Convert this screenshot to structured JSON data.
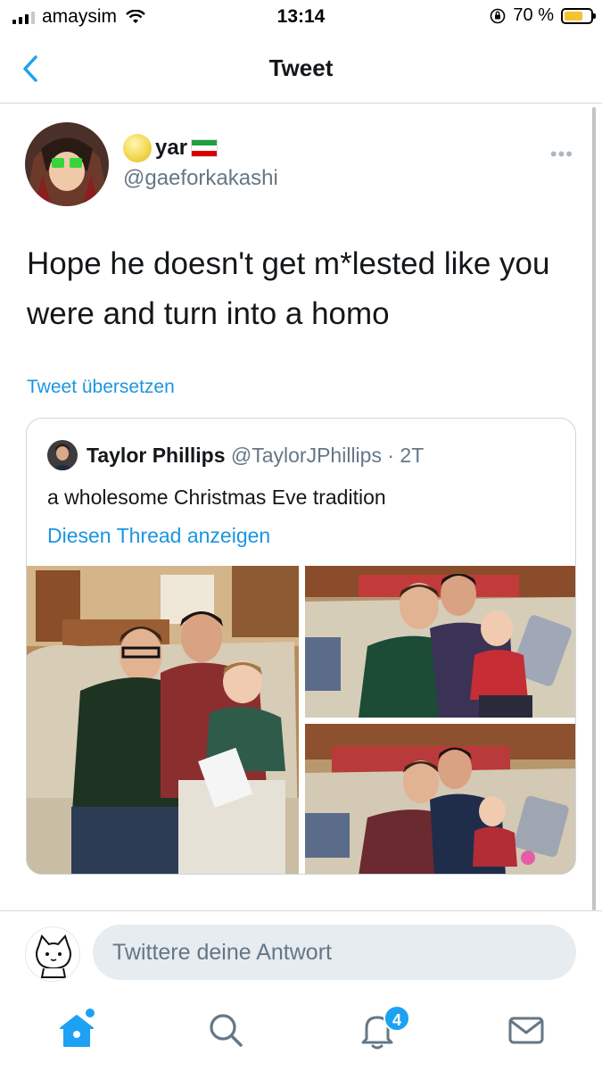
{
  "status_bar": {
    "carrier": "amaysim",
    "time": "13:14",
    "battery_percent": "70 %",
    "battery_level": 0.7
  },
  "nav": {
    "title": "Tweet",
    "back_icon": "chevron-left-icon"
  },
  "tweet": {
    "display_name": "yar",
    "name_prefix_emoji": "moon-icon",
    "name_suffix_emoji": "iran-flag-icon",
    "handle": "@gaeforkakashi",
    "text": "Hope he doesn't get m*lested like you were and turn into a homo",
    "translate_label": "Tweet übersetzen",
    "more_icon": "ellipsis-icon",
    "more_label": "•••"
  },
  "quoted_tweet": {
    "name": "Taylor Phillips",
    "handle": "@TaylorJPhillips",
    "separator": "·",
    "age": "2T",
    "text": "a wholesome Christmas Eve tradition",
    "thread_link": "Diesen Thread anzeigen",
    "photo_count": 3
  },
  "reply": {
    "placeholder": "Twittere deine Antwort"
  },
  "tab_bar": {
    "items": [
      "home-icon",
      "search-icon",
      "notifications-icon",
      "messages-icon"
    ],
    "active": "home-icon",
    "notification_badge": "4"
  },
  "colors": {
    "accent": "#1da1f2",
    "link": "#1b95e0",
    "text": "#14171a",
    "secondary": "#657786",
    "border": "#ccd6dd"
  }
}
